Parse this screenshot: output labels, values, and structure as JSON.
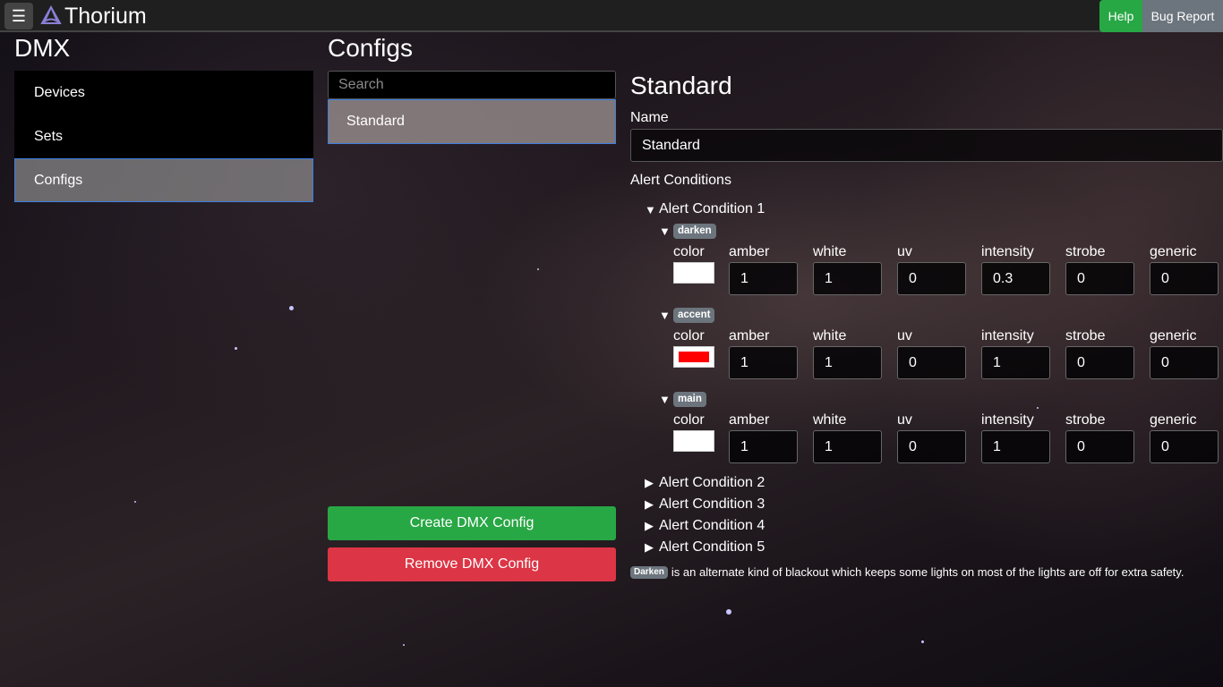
{
  "app": {
    "brand": "Thorium",
    "menu_icon": "hamburger-icon",
    "logo_icon": "thorium-logo-icon"
  },
  "header": {
    "help_label": "Help",
    "bug_label": "Bug Report"
  },
  "sidebar": {
    "title": "DMX",
    "items": [
      {
        "label": "Devices",
        "active": false
      },
      {
        "label": "Sets",
        "active": false
      },
      {
        "label": "Configs",
        "active": true
      }
    ]
  },
  "configs": {
    "title": "Configs",
    "search_placeholder": "Search",
    "list": [
      {
        "label": "Standard",
        "selected": true
      }
    ],
    "create_label": "Create DMX Config",
    "remove_label": "Remove DMX Config"
  },
  "detail": {
    "title": "Standard",
    "name_label": "Name",
    "name_value": "Standard",
    "alert_conditions_label": "Alert Conditions",
    "condition_1": {
      "label": "Alert Condition 1",
      "expanded": true,
      "groups": [
        {
          "badge": "darken",
          "color_label": "color",
          "color": "#ffffff",
          "labels": {
            "amber": "amber",
            "white": "white",
            "uv": "uv",
            "intensity": "intensity",
            "strobe": "strobe",
            "generic": "generic"
          },
          "values": {
            "amber": "1",
            "white": "1",
            "uv": "0",
            "intensity": "0.3",
            "strobe": "0",
            "generic": "0"
          }
        },
        {
          "badge": "accent",
          "color_label": "color",
          "color": "#ff0000",
          "labels": {
            "amber": "amber",
            "white": "white",
            "uv": "uv",
            "intensity": "intensity",
            "strobe": "strobe",
            "generic": "generic"
          },
          "values": {
            "amber": "1",
            "white": "1",
            "uv": "0",
            "intensity": "1",
            "strobe": "0",
            "generic": "0"
          }
        },
        {
          "badge": "main",
          "color_label": "color",
          "color": "#ffffff",
          "labels": {
            "amber": "amber",
            "white": "white",
            "uv": "uv",
            "intensity": "intensity",
            "strobe": "strobe",
            "generic": "generic"
          },
          "values": {
            "amber": "1",
            "white": "1",
            "uv": "0",
            "intensity": "1",
            "strobe": "0",
            "generic": "0"
          }
        }
      ]
    },
    "collapsed_conditions": [
      "Alert Condition 2",
      "Alert Condition 3",
      "Alert Condition 4",
      "Alert Condition 5"
    ],
    "footnote": {
      "badge": "Darken",
      "text": "is an alternate kind of blackout which keeps some lights on most of the lights are off for extra safety."
    }
  },
  "colors": {
    "success": "#28a745",
    "danger": "#dc3545",
    "secondary": "#6c757d",
    "focus_border": "#3d7fe0"
  }
}
